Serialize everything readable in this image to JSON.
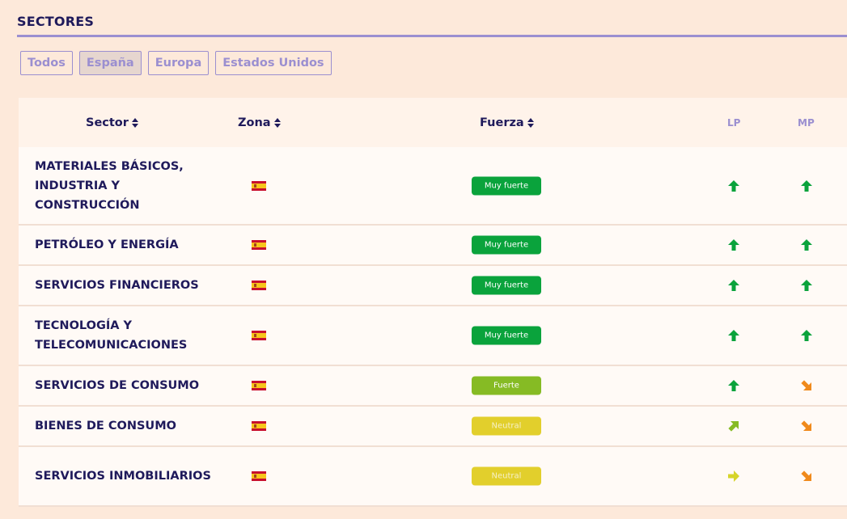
{
  "title": "SECTORES",
  "filters": [
    {
      "label": "Todos",
      "active": false
    },
    {
      "label": "España",
      "active": true
    },
    {
      "label": "Europa",
      "active": false
    },
    {
      "label": "Estados Unidos",
      "active": false
    }
  ],
  "columns": {
    "sector": "Sector",
    "zona": "Zona",
    "fuerza": "Fuerza",
    "lp": "LP",
    "mp": "MP"
  },
  "colors": {
    "accent": "#9b8fd0",
    "text": "#1f1a5b",
    "muy_fuerte": "#0aa33c",
    "fuerte": "#86bb24",
    "neutral": "#e2cf2c",
    "arrow_green": "#0aa33c",
    "arrow_lightgreen": "#86bb24",
    "arrow_yellow": "#d6d42a",
    "arrow_orange": "#f08a1c"
  },
  "rows": [
    {
      "sector": "MATERIALES BÁSICOS, INDUSTRIA Y CONSTRUCCIÓN",
      "zona_icon": "spain-flag-icon",
      "fuerza": "Muy fuerte",
      "fuerza_level": "muy_fuerte",
      "lp": "up",
      "mp": "up"
    },
    {
      "sector": "PETRÓLEO Y ENERGÍA",
      "zona_icon": "spain-flag-icon",
      "fuerza": "Muy fuerte",
      "fuerza_level": "muy_fuerte",
      "lp": "up",
      "mp": "up"
    },
    {
      "sector": "SERVICIOS FINANCIEROS",
      "zona_icon": "spain-flag-icon",
      "fuerza": "Muy fuerte",
      "fuerza_level": "muy_fuerte",
      "lp": "up",
      "mp": "up"
    },
    {
      "sector": "TECNOLOGÍA Y TELECOMUNICACIONES",
      "zona_icon": "spain-flag-icon",
      "fuerza": "Muy fuerte",
      "fuerza_level": "muy_fuerte",
      "lp": "up",
      "mp": "up"
    },
    {
      "sector": "SERVICIOS DE CONSUMO",
      "zona_icon": "spain-flag-icon",
      "fuerza": "Fuerte",
      "fuerza_level": "fuerte",
      "lp": "up",
      "mp": "down-right"
    },
    {
      "sector": "BIENES DE CONSUMO",
      "zona_icon": "spain-flag-icon",
      "fuerza": "Neutral",
      "fuerza_level": "neutral",
      "lp": "up-right",
      "mp": "down-right"
    },
    {
      "sector": "SERVICIOS INMOBILIARIOS",
      "zona_icon": "spain-flag-icon",
      "fuerza": "Neutral",
      "fuerza_level": "neutral",
      "lp": "right",
      "mp": "down-right"
    }
  ]
}
